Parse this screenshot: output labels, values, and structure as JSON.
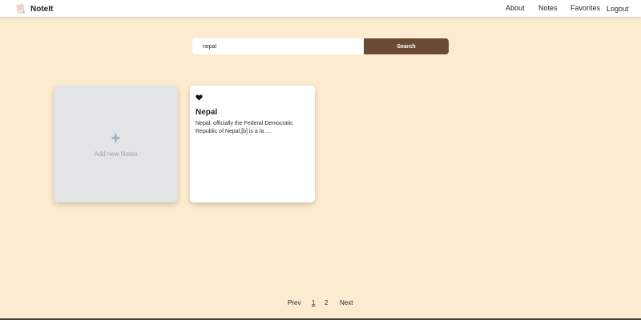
{
  "app": {
    "name": "NoteIt",
    "logo_icon": "notepad-icon"
  },
  "nav": {
    "links": [
      {
        "label": "About"
      },
      {
        "label": "Notes"
      },
      {
        "label": "Favorites"
      },
      {
        "label": "Logout"
      }
    ]
  },
  "search": {
    "value": "nepal",
    "placeholder": "",
    "button_label": "Search"
  },
  "add_card": {
    "icon": "plus-icon",
    "plus_glyph": "+",
    "label": "Add new Notes"
  },
  "notes": [
    {
      "favorite_icon": "heart-icon",
      "title": "Nepal",
      "body": "Nepal, officially the Federal Democratic Republic of Nepal,[b] is a la ...."
    }
  ],
  "pagination": {
    "prev_label": "Prev",
    "pages": [
      "1",
      "2"
    ],
    "current_page": "1",
    "next_label": "Next"
  },
  "colors": {
    "background": "#fdebcf",
    "accent_button": "#6b4a33",
    "add_card_bg": "#e3e3e8",
    "add_card_text": "#9aa7bd"
  }
}
